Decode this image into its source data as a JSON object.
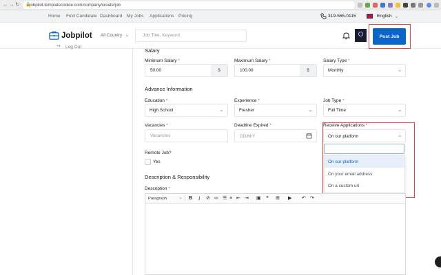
{
  "browser": {
    "url": "jobpilot.templatecookie.com/company/create/job",
    "nav_back": "←",
    "nav_forward": "→",
    "nav_reload": "↻",
    "nav_home": "⌂"
  },
  "topnav": {
    "links": [
      "Home",
      "Find Candidate",
      "Dashboard",
      "My Jobs",
      "Applications",
      "Pricing"
    ],
    "phone": "319-555-0115",
    "language": "English"
  },
  "header": {
    "logo_text": "Jobpilot",
    "country_select": "All Country",
    "search_placeholder": "Job Title, Keyword",
    "post_job_button": "Post Job"
  },
  "sidebar": {
    "logout_label": "Log Out"
  },
  "form": {
    "salary": {
      "section_title": "Salary",
      "min_label": "Minimum Salary",
      "min_value": "50.00",
      "max_label": "Maximum Salary",
      "max_value": "100.00",
      "currency_addon": "$",
      "type_label": "Salary Type",
      "type_value": "Monthly"
    },
    "advance": {
      "section_title": "Advance Information",
      "education_label": "Education",
      "education_value": "High School",
      "experience_label": "Experience",
      "experience_value": "Fresher",
      "job_type_label": "Job Type",
      "job_type_value": "Full Time",
      "vacancies_label": "Vacancies",
      "vacancies_placeholder": "Vacancies",
      "deadline_label": "Deadline Expired",
      "deadline_placeholder": "DD/M/Y",
      "receive_label": "Receive Applications",
      "receive_value": "On our platform",
      "receive_options": [
        "On our platform",
        "On your email address",
        "On a custom url"
      ],
      "remote_label": "Remote Job?",
      "remote_option": "Yes"
    },
    "description": {
      "section_title": "Description & Responsibility",
      "label": "Description",
      "paragraph_select": "Paragraph"
    },
    "required_mark": "*"
  },
  "colors": {
    "primary": "#0a65cc",
    "highlight_box": "#e0443a"
  }
}
